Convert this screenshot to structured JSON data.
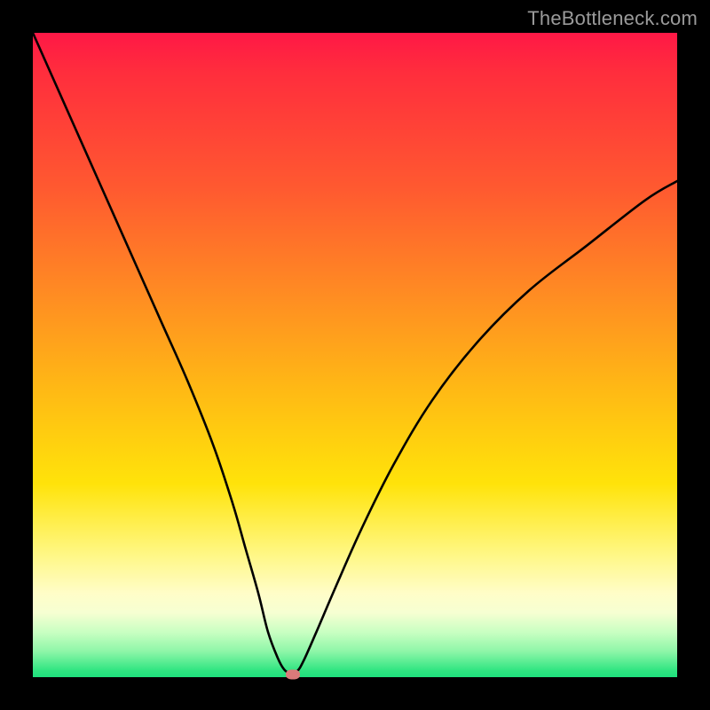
{
  "watermark": "TheBottleneck.com",
  "colors": {
    "page_bg": "#000000",
    "curve_stroke": "#000000",
    "marker_fill": "#d97a7a",
    "gradient_top": "#ff1846",
    "gradient_bottom": "#1ee07d"
  },
  "chart_data": {
    "type": "line",
    "title": "",
    "xlabel": "",
    "ylabel": "",
    "xlim": [
      0,
      100
    ],
    "ylim": [
      0,
      100
    ],
    "grid": false,
    "legend": false,
    "series": [
      {
        "name": "bottleneck_curve",
        "x": [
          0,
          4,
          8,
          12,
          16,
          20,
          24,
          28,
          31,
          33,
          35,
          36.5,
          38,
          39,
          40,
          41,
          42,
          44,
          47,
          51,
          56,
          62,
          69,
          77,
          86,
          95,
          100
        ],
        "y": [
          100,
          91,
          82,
          73,
          64,
          55,
          46,
          36,
          27,
          20,
          13,
          7,
          3,
          1.2,
          0.6,
          0.9,
          2.5,
          7,
          14,
          23,
          33,
          43,
          52,
          60,
          67,
          74,
          77
        ]
      }
    ],
    "marker": {
      "x": 40.3,
      "y": 0.4
    }
  }
}
